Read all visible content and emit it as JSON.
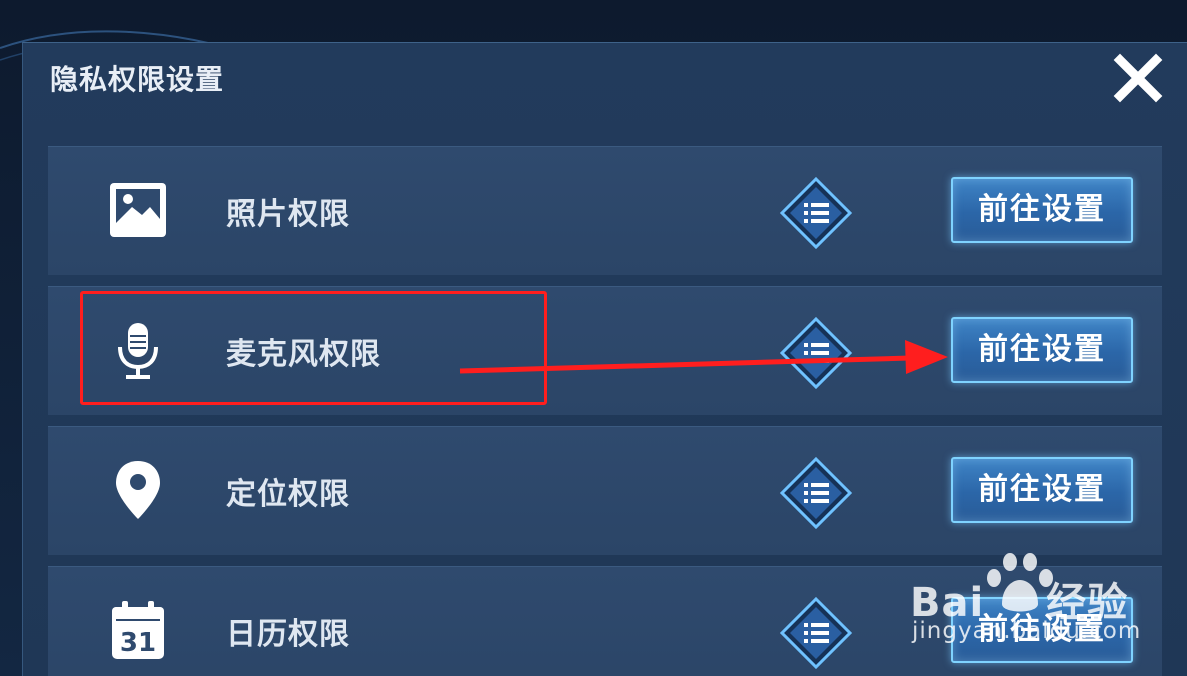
{
  "dialog": {
    "title": "隐私权限设置",
    "close_icon": "close-icon"
  },
  "permissions": [
    {
      "label": "照片权限",
      "icon": "photo-icon",
      "button": "前往设置"
    },
    {
      "label": "麦克风权限",
      "icon": "microphone-icon",
      "button": "前往设置"
    },
    {
      "label": "定位权限",
      "icon": "location-pin-icon",
      "button": "前往设置"
    },
    {
      "label": "日历权限",
      "icon": "calendar-icon",
      "calendar_day": "31",
      "button": "前往设置"
    }
  ],
  "annotation": {
    "highlight_color": "#ff1e1e",
    "highlight_target": "麦克风权限",
    "arrow_target": "前往设置"
  },
  "watermark": {
    "brand": "Bai",
    "brand_suffix": "经验",
    "url": "jingyan.baidu.com"
  },
  "colors": {
    "panel": "#223b5c",
    "row": "#2f4a6e",
    "button": "#3a7bc0",
    "button_border": "#7fd3ff",
    "text": "#dfe7f1"
  }
}
